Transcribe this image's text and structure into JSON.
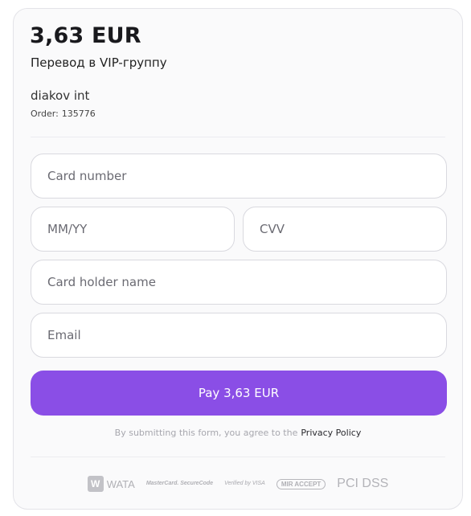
{
  "order": {
    "amount": "3,63 EUR",
    "description": "Перевод в VIP-группу",
    "merchant": "diakov int",
    "order_label": "Order:",
    "order_number": "135776"
  },
  "form": {
    "card_number_placeholder": "Card number",
    "expiry_placeholder": "MM/YY",
    "cvv_placeholder": "CVV",
    "holder_placeholder": "Card holder name",
    "email_placeholder": "Email",
    "pay_label": "Pay 3,63 EUR"
  },
  "footer": {
    "terms_text": "By submitting this form, you agree to the",
    "privacy_link": "Privacy Policy",
    "logos": [
      {
        "name": "wata-logo",
        "text": "WATA"
      },
      {
        "name": "mastercard-securecode-logo",
        "text": "MasterCard. SecureCode"
      },
      {
        "name": "verified-by-visa-logo",
        "text": "Verified by VISA"
      },
      {
        "name": "mir-accept-logo",
        "text": "MIR ACCEPT"
      },
      {
        "name": "pci-dss-logo",
        "text": "PCI DSS"
      }
    ]
  },
  "colors": {
    "accent": "#8a4ee6",
    "card_bg": "#fafafb",
    "border": "#d9d9df"
  }
}
